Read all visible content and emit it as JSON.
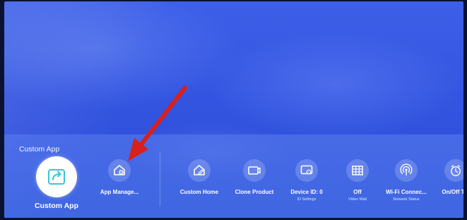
{
  "section_title": "Custom App",
  "colors": {
    "accent": "#ffffff",
    "background": "#3354e0",
    "arrow": "#d8201c"
  },
  "selected_app": {
    "label": "Custom App",
    "icon": "share-house-icon"
  },
  "tiles": [
    {
      "label": "App Manage...",
      "sub": "",
      "icon": "house-gear-icon"
    },
    {
      "label": "Custom Home",
      "sub": "",
      "icon": "house-edit-icon"
    },
    {
      "label": "Clone Product",
      "sub": "",
      "icon": "clone-device-icon"
    },
    {
      "label": "Device ID: 0",
      "sub": "ID Settings",
      "icon": "monitor-gear-icon"
    },
    {
      "label": "Off",
      "sub": "Video Wall",
      "icon": "grid-icon"
    },
    {
      "label": "Wi-Fi Connec...",
      "sub": "Network Status",
      "icon": "wifi-signal-icon"
    },
    {
      "label": "On/Off Tin",
      "sub": "",
      "icon": "clock-icon"
    }
  ]
}
